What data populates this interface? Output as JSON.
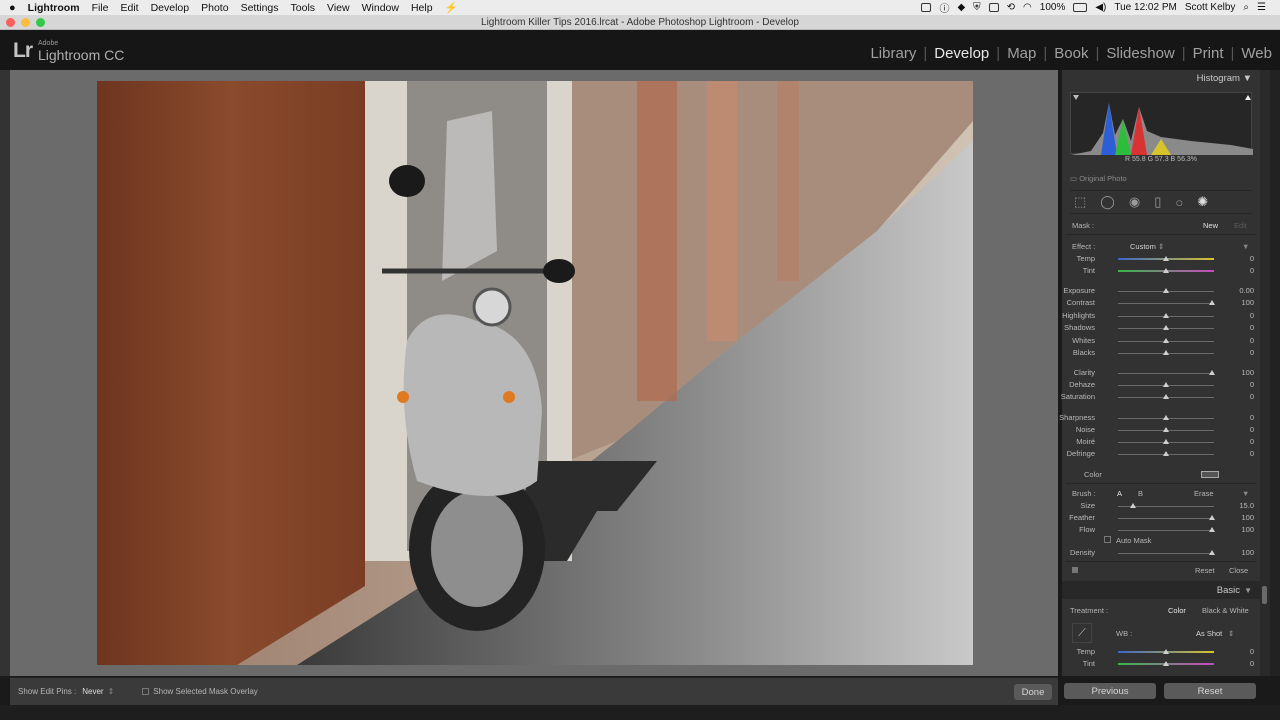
{
  "menubar": {
    "apple": "",
    "app": "Lightroom",
    "items": [
      "File",
      "Edit",
      "Develop",
      "Photo",
      "Settings",
      "Tools",
      "View",
      "Window",
      "Help"
    ],
    "battery": "100%",
    "clock": "Tue 12:02 PM",
    "user": "Scott Kelby"
  },
  "titlebar": {
    "title": "Lightroom Killer Tips 2016.lrcat - Adobe Photoshop Lightroom - Develop"
  },
  "identity": {
    "lr": "Lr",
    "adobe": "Adobe",
    "name": "Lightroom CC"
  },
  "modules": [
    "Library",
    "Develop",
    "Map",
    "Book",
    "Slideshow",
    "Print",
    "Web"
  ],
  "active_module": "Develop",
  "toolbar": {
    "edit_pins_label": "Show Edit Pins :",
    "edit_pins_value": "Never",
    "mask_overlay_label": "Show Selected Mask Overlay",
    "done": "Done"
  },
  "histogram": {
    "title": "Histogram",
    "r_label": "R",
    "r_value": "55.8",
    "g_label": "G",
    "g_value": "57.3",
    "b_label": "B",
    "b_value": "56.3",
    "unit": "%",
    "original_photo": "Original Photo"
  },
  "mask": {
    "label": "Mask :",
    "new": "New",
    "edit": "Edit"
  },
  "effect": {
    "label": "Effect :",
    "value": "Custom"
  },
  "sliders_effect": [
    {
      "label": "Temp",
      "value": "0",
      "pos": 0.5
    },
    {
      "label": "Tint",
      "value": "0",
      "pos": 0.5
    }
  ],
  "sliders_tone": [
    {
      "label": "Exposure",
      "value": "0.00",
      "pos": 0.5
    },
    {
      "label": "Contrast",
      "value": "100",
      "pos": 0.98
    },
    {
      "label": "Highlights",
      "value": "0",
      "pos": 0.5
    },
    {
      "label": "Shadows",
      "value": "0",
      "pos": 0.5
    },
    {
      "label": "Whites",
      "value": "0",
      "pos": 0.5
    },
    {
      "label": "Blacks",
      "value": "0",
      "pos": 0.5
    }
  ],
  "sliders_presence": [
    {
      "label": "Clarity",
      "value": "100",
      "pos": 0.98
    },
    {
      "label": "Dehaze",
      "value": "0",
      "pos": 0.5
    },
    {
      "label": "Saturation",
      "value": "0",
      "pos": 0.5
    }
  ],
  "sliders_detail": [
    {
      "label": "Sharpness",
      "value": "0",
      "pos": 0.5
    },
    {
      "label": "Noise",
      "value": "0",
      "pos": 0.5
    },
    {
      "label": "Moiré",
      "value": "0",
      "pos": 0.5
    },
    {
      "label": "Defringe",
      "value": "0",
      "pos": 0.5
    }
  ],
  "color_label": "Color",
  "brush": {
    "label": "Brush :",
    "a": "A",
    "b": "B",
    "erase": "Erase",
    "sliders": [
      {
        "label": "Size",
        "value": "15.0",
        "pos": 0.16
      },
      {
        "label": "Feather",
        "value": "100",
        "pos": 0.98
      },
      {
        "label": "Flow",
        "value": "100",
        "pos": 0.98
      }
    ],
    "auto_mask": "Auto Mask",
    "density": {
      "label": "Density",
      "value": "100",
      "pos": 0.98
    },
    "reset": "Reset",
    "close": "Close"
  },
  "basic": {
    "title": "Basic",
    "treatment_label": "Treatment :",
    "color": "Color",
    "bw": "Black & White",
    "wb_label": "WB :",
    "wb_value": "As Shot",
    "sliders": [
      {
        "label": "Temp",
        "value": "0",
        "pos": 0.5
      },
      {
        "label": "Tint",
        "value": "0",
        "pos": 0.5
      }
    ]
  },
  "buttons": {
    "previous": "Previous",
    "reset": "Reset"
  }
}
